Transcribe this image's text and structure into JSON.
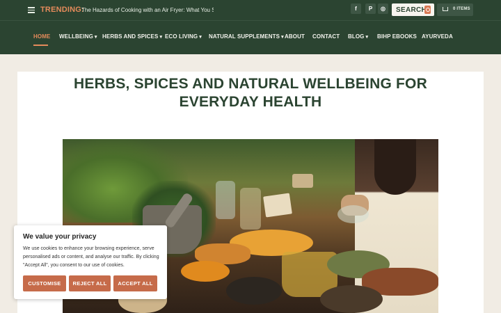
{
  "topbar": {
    "trending_label": "TRENDING:",
    "trending_text": "The Hazards of Cooking with an Air Fryer: What You Shou...",
    "social": [
      {
        "icon": "facebook-icon",
        "glyph": "f"
      },
      {
        "icon": "pinterest-icon",
        "glyph": "P"
      },
      {
        "icon": "instagram-icon",
        "glyph": "◎"
      }
    ],
    "search_label": "SEARCH",
    "cart_label": "0 ITEMS"
  },
  "nav": {
    "items": [
      {
        "label": "HOME",
        "dropdown": false
      },
      {
        "label": "WELLBEING",
        "dropdown": true
      },
      {
        "label": "HERBS AND SPICES",
        "dropdown": true
      },
      {
        "label": "ECO LIVING",
        "dropdown": true
      },
      {
        "label": "NATURAL SUPPLEMENTS",
        "dropdown": true
      },
      {
        "label": "ABOUT",
        "dropdown": false
      },
      {
        "label": "CONTACT",
        "dropdown": false
      },
      {
        "label": "BLOG",
        "dropdown": true
      },
      {
        "label": "BIHP EBOOKS",
        "dropdown": false
      },
      {
        "label": "AYURVEDA",
        "dropdown": false
      }
    ],
    "caret": "▾"
  },
  "main": {
    "headline_line1": "HERBS, SPICES AND NATURAL WELLBEING FOR",
    "headline_line2": "EVERYDAY HEALTH"
  },
  "cookie": {
    "title": "We value your privacy",
    "body": "We use cookies to enhance your browsing experience, serve personalised ads or content, and analyse our traffic. By clicking \"Accept All\", you consent to our use of cookies.",
    "buttons": {
      "customise": "CUSTOMISE",
      "reject": "REJECT ALL",
      "accept": "ACCEPT ALL"
    }
  },
  "colors": {
    "header_green": "#2b4431",
    "accent_orange": "#e58b5b",
    "button_terracotta": "#c66b4a",
    "page_background": "#f1ece4"
  }
}
